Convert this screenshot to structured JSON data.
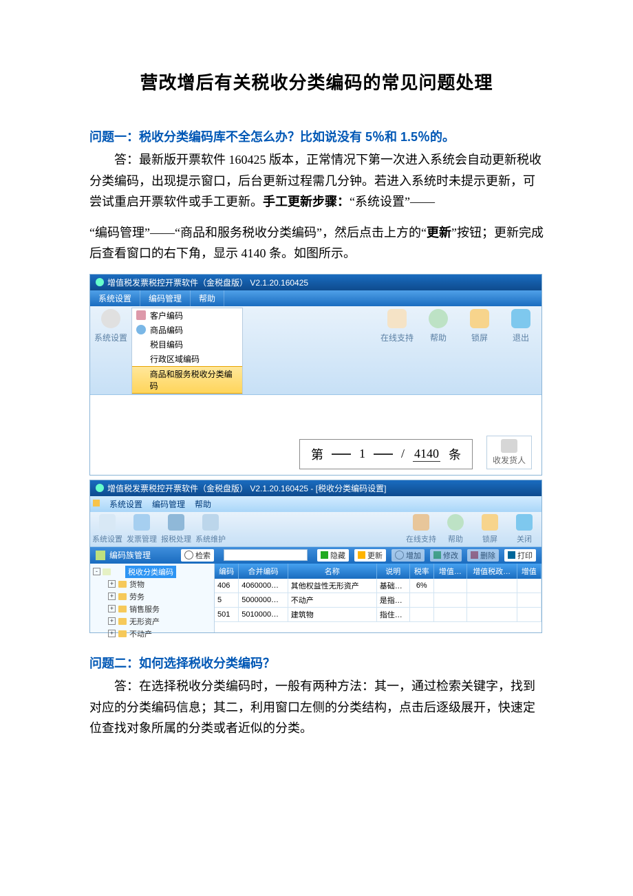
{
  "doc": {
    "title": "营改增后有关税收分类编码的常见问题处理",
    "q1": {
      "title": "问题一：税收分类编码库不全怎么办？比如说没有 5％和 1.5％的。",
      "answer_prefix": "答：最新版开票软件 160425 版本，正常情况下第一次进入系统会自动更新税收分类编码，出现提示窗口，后台更新过程需几分钟。若进入系统时未提示更新，可尝试重启开票软件或手工更新。",
      "bold_step": "手工更新步骤：",
      "answer_mid": "“系统设置”——",
      "answer_cont1": "“编码管理”——“商品和服务税收分类编码”，然后点击上方的“",
      "bold_update": "更新",
      "answer_cont2": "”按钮；更新完成后查看窗口的右下角，显示 4140 条。如图所示。"
    },
    "q2": {
      "title": "问题二：如何选择税收分类编码？",
      "answer": "答：在选择税收分类编码时，一般有两种方法：其一，通过检索关键字，找到对应的分类编码信息；其二，利用窗口左侧的分类结构，点击后逐级展开，快速定位查找对象所属的分类或者近似的分类。"
    }
  },
  "app1": {
    "title": "增值税发票税控开票软件（金税盘版）  V2.1.20.160425",
    "menu": [
      "系统设置",
      "编码管理",
      "帮助"
    ],
    "sysset_label": "系统设置",
    "dropdown": [
      "客户编码",
      "商品编码",
      "税目编码",
      "行政区域编码",
      "商品和服务税收分类编码"
    ],
    "right_buttons": [
      {
        "icon": "support",
        "label": "在线支持"
      },
      {
        "icon": "help",
        "label": "帮助"
      },
      {
        "icon": "lock",
        "label": "锁屏"
      },
      {
        "icon": "back",
        "label": "退出"
      }
    ],
    "pager": {
      "pre": "第",
      "page": "1",
      "sep": "/",
      "total": "4140",
      "suf": "条"
    },
    "receiver": "收发货人"
  },
  "app2": {
    "title": "增值税发票税控开票软件（金税盘版）  V2.1.20.160425 - [税收分类编码设置]",
    "menu2": [
      "系统设置",
      "编码管理",
      "帮助"
    ],
    "toolbar_left": [
      {
        "icon": "gear",
        "label": "系统设置"
      },
      {
        "icon": "calendar",
        "label": "发票管理"
      },
      {
        "icon": "monitor",
        "label": "报税处理"
      },
      {
        "icon": "wrench",
        "label": "系统维护"
      }
    ],
    "toolbar_right": [
      {
        "icon": "support",
        "label": "在线支持"
      },
      {
        "icon": "help",
        "label": "帮助"
      },
      {
        "icon": "lock",
        "label": "锁屏"
      },
      {
        "icon": "back",
        "label": "关闭"
      }
    ],
    "mid_title": "编码族管理",
    "mid_buttons": {
      "search": "检索",
      "hide": "隐藏",
      "update": "更新",
      "add": "增加",
      "edit": "修改",
      "del": "删除",
      "print": "打印"
    },
    "tree": {
      "root": "税收分类编码",
      "nodes": [
        "货物",
        "劳务",
        "销售服务",
        "无形资产",
        "不动产"
      ]
    },
    "table": {
      "headers": [
        "编码",
        "合并编码",
        "名称",
        "说明",
        "税率",
        "增值…",
        "增值税政…",
        "增值"
      ],
      "rows": [
        {
          "code": "406",
          "merge": "4060000…",
          "name": "其他权益性无形资产",
          "desc": "基础…",
          "rate": "6%",
          "v1": "",
          "v2": "",
          "v3": ""
        },
        {
          "code": "5",
          "merge": "5000000…",
          "name": "不动产",
          "desc": "是指…",
          "rate": "",
          "v1": "",
          "v2": "",
          "v3": ""
        },
        {
          "code": "501",
          "merge": "5010000…",
          "name": "建筑物",
          "desc": "指住…",
          "rate": "",
          "v1": "",
          "v2": "",
          "v3": ""
        }
      ]
    }
  }
}
